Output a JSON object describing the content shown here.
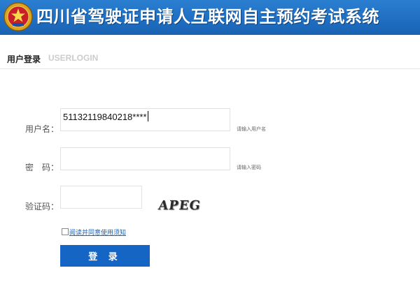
{
  "header": {
    "title": "四川省驾驶证申请人互联网自主预约考试系统",
    "emblem_icon": "police-emblem-icon"
  },
  "login_tab": {
    "title": "用户登录",
    "subtitle": "USERLOGIN"
  },
  "form": {
    "username": {
      "label": "用户名：",
      "value": "51132119840218****",
      "hint": "请输入用户名"
    },
    "password": {
      "label": "密　码：",
      "value": "",
      "hint": "请输入密码"
    },
    "captcha": {
      "label": "验证码：",
      "value": "",
      "image_text": "APEG"
    },
    "agree_text": "阅读并同意使用须知",
    "submit_label": "登 录"
  },
  "colors": {
    "header_blue": "#1f6fc3",
    "button_blue": "#1565c4",
    "link_blue": "#1a62b2"
  }
}
